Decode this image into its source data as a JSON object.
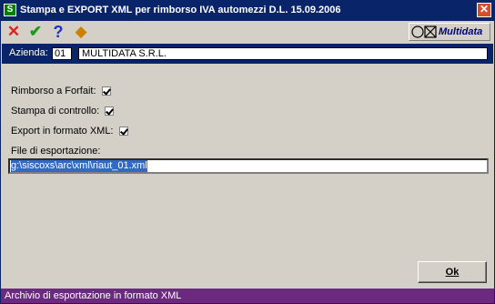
{
  "window": {
    "title": "Stampa e EXPORT XML per rimborso IVA automezzi D.L. 15.09.2006",
    "icon_letter": "S",
    "close_glyph": "✕"
  },
  "toolbar": {
    "buttons": [
      {
        "icon": "cancel-icon",
        "glyph": "✕",
        "color": "#e02020"
      },
      {
        "icon": "confirm-icon",
        "glyph": "✔",
        "color": "#1a9a1a"
      },
      {
        "icon": "help-icon",
        "glyph": "?",
        "color": "#2030c0"
      },
      {
        "icon": "utility-icon",
        "glyph": "◆",
        "color": "#d08000"
      }
    ],
    "brand": "Multidata"
  },
  "azienda": {
    "label": "Azienda:",
    "code": "01",
    "name": "MULTIDATA S.R.L."
  },
  "options": [
    {
      "label": "Rimborso a Forfait:",
      "checked": true
    },
    {
      "label": "Stampa di controllo:",
      "checked": true
    },
    {
      "label": "Export in formato XML:",
      "checked": true
    }
  ],
  "file": {
    "label": "File di esportazione:",
    "value": "g:\\siscoxs\\arc\\xml\\riaut_01.xml"
  },
  "ok_label": "Ok",
  "status": "Archivio di esportazione in formato XML"
}
